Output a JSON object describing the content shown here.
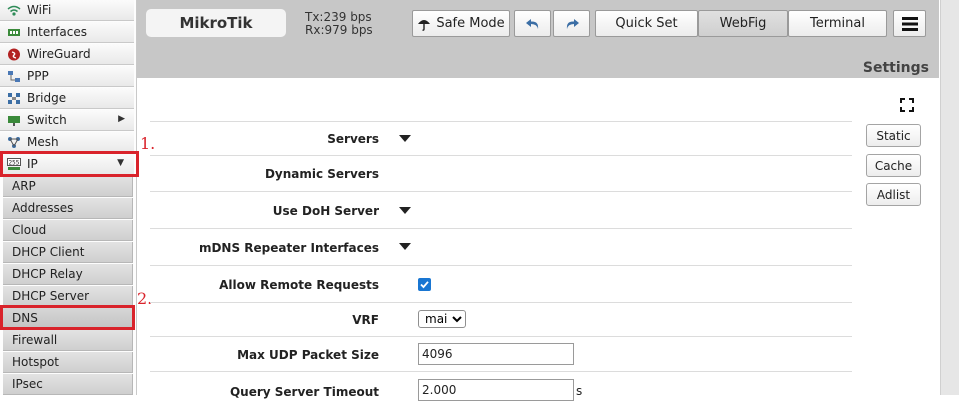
{
  "sidebar": {
    "items": [
      {
        "label": "WiFi",
        "icon": "wifi-icon"
      },
      {
        "label": "Interfaces",
        "icon": "interfaces-icon"
      },
      {
        "label": "WireGuard",
        "icon": "wireguard-icon"
      },
      {
        "label": "PPP",
        "icon": "ppp-icon"
      },
      {
        "label": "Bridge",
        "icon": "bridge-icon"
      },
      {
        "label": "Switch",
        "icon": "switch-icon"
      },
      {
        "label": "Mesh",
        "icon": "mesh-icon"
      },
      {
        "label": "IP",
        "icon": "ip-icon"
      }
    ],
    "ip_submenu": [
      "ARP",
      "Addresses",
      "Cloud",
      "DHCP Client",
      "DHCP Relay",
      "DHCP Server",
      "DNS",
      "Firewall",
      "Hotspot",
      "IPsec"
    ]
  },
  "annotations": {
    "step1": "1.",
    "step2": "2.",
    "color": "#d9232b"
  },
  "header": {
    "brand": "MikroTik",
    "tx": "Tx:239 bps",
    "rx": "Rx:979 bps",
    "safe_mode": "Safe Mode",
    "tabs": [
      "Quick Set",
      "WebFig",
      "Terminal"
    ],
    "active_tab": "WebFig",
    "page_title": "Settings"
  },
  "form": {
    "servers": "Servers",
    "dynamic_servers": "Dynamic Servers",
    "use_doh_server": "Use DoH Server",
    "mdns_repeater": "mDNS Repeater Interfaces",
    "allow_remote_requests": "Allow Remote Requests",
    "allow_remote_requests_checked": true,
    "vrf": "VRF",
    "vrf_value": "main",
    "max_udp_packet_size": "Max UDP Packet Size",
    "max_udp_packet_size_value": "4096",
    "query_server_timeout": "Query Server Timeout",
    "query_server_timeout_value": "2.000",
    "query_server_timeout_unit": "s"
  },
  "actions": {
    "static": "Static",
    "cache": "Cache",
    "adlist": "Adlist"
  },
  "colors": {
    "accent": "#1976d2",
    "topbar": "#c7c7c7",
    "highlight": "#d9232b"
  }
}
